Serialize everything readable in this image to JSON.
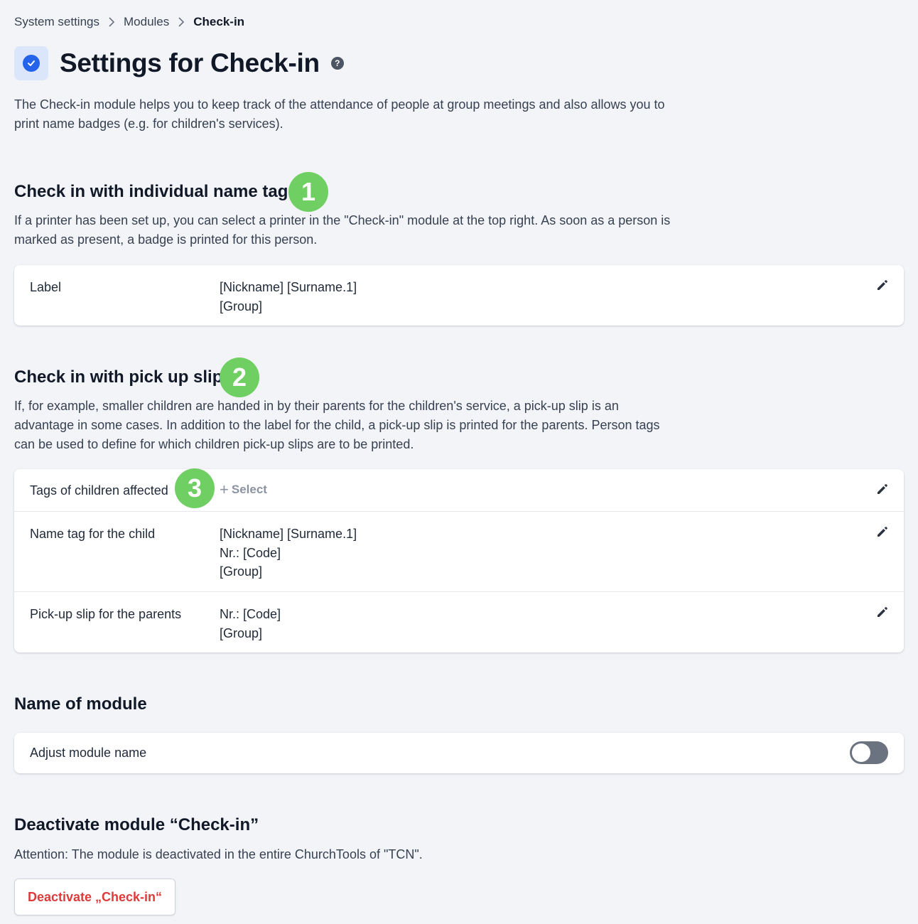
{
  "breadcrumb": {
    "items": [
      "System settings",
      "Modules",
      "Check-in"
    ]
  },
  "header": {
    "title": "Settings for Check-in",
    "help_label": "?",
    "description": "The Check-in module helps you to keep track of the attendance of people at group meetings and also allows you to print name badges (e.g. for children's services)."
  },
  "sections": {
    "name_tags": {
      "title": "Check in with individual name tags",
      "marker": "1",
      "description": "If a printer has been set up, you can select a printer in the \"Check-in\" module at the top right. As soon as a person is marked as present, a badge is printed for this person.",
      "rows": [
        {
          "label": "Label",
          "lines": [
            "[Nickname] [Surname.1]",
            "[Group]"
          ]
        }
      ]
    },
    "pickup": {
      "title": "Check in with pick up slip",
      "marker": "2",
      "description": "If, for example, smaller children are handed in by their parents for the children's service, a pick-up slip is an advantage in some cases. In addition to the label for the child, a pick-up slip is printed for the parents. Person tags can be used to define for which children pick-up slips are to be printed.",
      "tags_label": "Tags of children affected",
      "tags_marker": "3",
      "select_label": "Select",
      "select_plus": "+",
      "rows": [
        {
          "label": "Name tag for the child",
          "lines": [
            "[Nickname] [Surname.1]",
            "Nr.: [Code]",
            "[Group]"
          ]
        },
        {
          "label": "Pick-up slip for the parents",
          "lines": [
            "Nr.: [Code]",
            "[Group]"
          ]
        }
      ]
    },
    "module_name": {
      "title": "Name of module",
      "row_label": "Adjust module name",
      "toggle_on": false
    },
    "deactivate": {
      "title": "Deactivate module “Check-in”",
      "description": "Attention: The module is deactivated in the entire ChurchTools of \"TCN\".",
      "button_label": "Deactivate „Check-in“"
    }
  },
  "colors": {
    "background": "#f2f4f8",
    "accent": "#2563eb",
    "marker": "#6fcf62",
    "danger": "#dc3b3b"
  },
  "icons": [
    "chevron-right-icon",
    "check-circle-icon",
    "help-icon",
    "pencil-icon",
    "plus-icon"
  ]
}
